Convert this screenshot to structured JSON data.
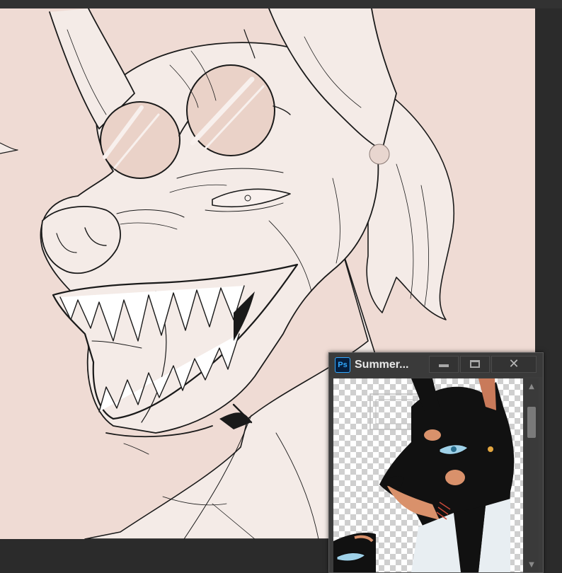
{
  "app": {
    "preview_window": {
      "icon_label": "Ps",
      "title": "Summer...",
      "controls": {
        "minimize": "minimize",
        "maximize": "maximize",
        "close": "✕"
      }
    }
  },
  "colors": {
    "canvas_bg": "#efdbd4",
    "skin": "#f4ebe7",
    "lineart": "#1a1a1a",
    "glasses_lens": "#ead2c8",
    "workspace": "#2b2b2b",
    "ps_blue": "#31a8ff"
  },
  "icons": [
    "photoshop-app-icon",
    "minimize-icon",
    "maximize-icon",
    "close-icon",
    "scroll-up-icon",
    "scroll-down-icon"
  ]
}
